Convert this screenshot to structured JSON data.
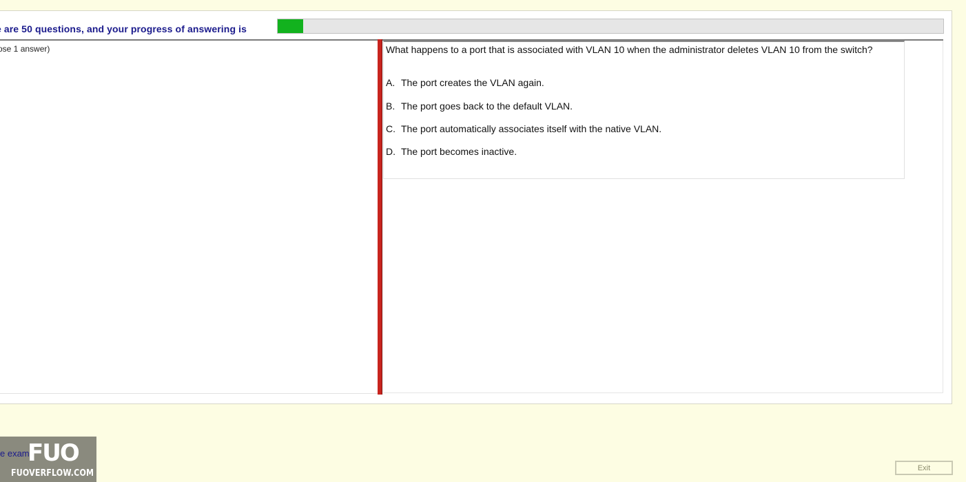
{
  "header": {
    "progress_label": "e are 50 questions, and your progress of answering is",
    "progress_fraction": 0.038,
    "progress_color": "#12b21e"
  },
  "instruction": "ose 1 answer)",
  "question": {
    "text": "What happens to a port that is associated with VLAN 10 when the administrator deletes VLAN 10 from the switch?",
    "options": [
      {
        "letter": "A.",
        "text": "The port creates the VLAN again."
      },
      {
        "letter": "B.",
        "text": "The port goes back to the default VLAN."
      },
      {
        "letter": "C.",
        "text": "The port automatically associates itself with the native VLAN."
      },
      {
        "letter": "D.",
        "text": "The port becomes inactive."
      }
    ]
  },
  "footer": {
    "exit_label": "Exit",
    "partial_link_text": "e exam"
  },
  "watermark": {
    "logo": "FUO",
    "site": "FUOVERFLOW.COM"
  },
  "colors": {
    "background": "#fdfde3",
    "divider": "#c8241e",
    "header_text": "#1a1a8c"
  }
}
